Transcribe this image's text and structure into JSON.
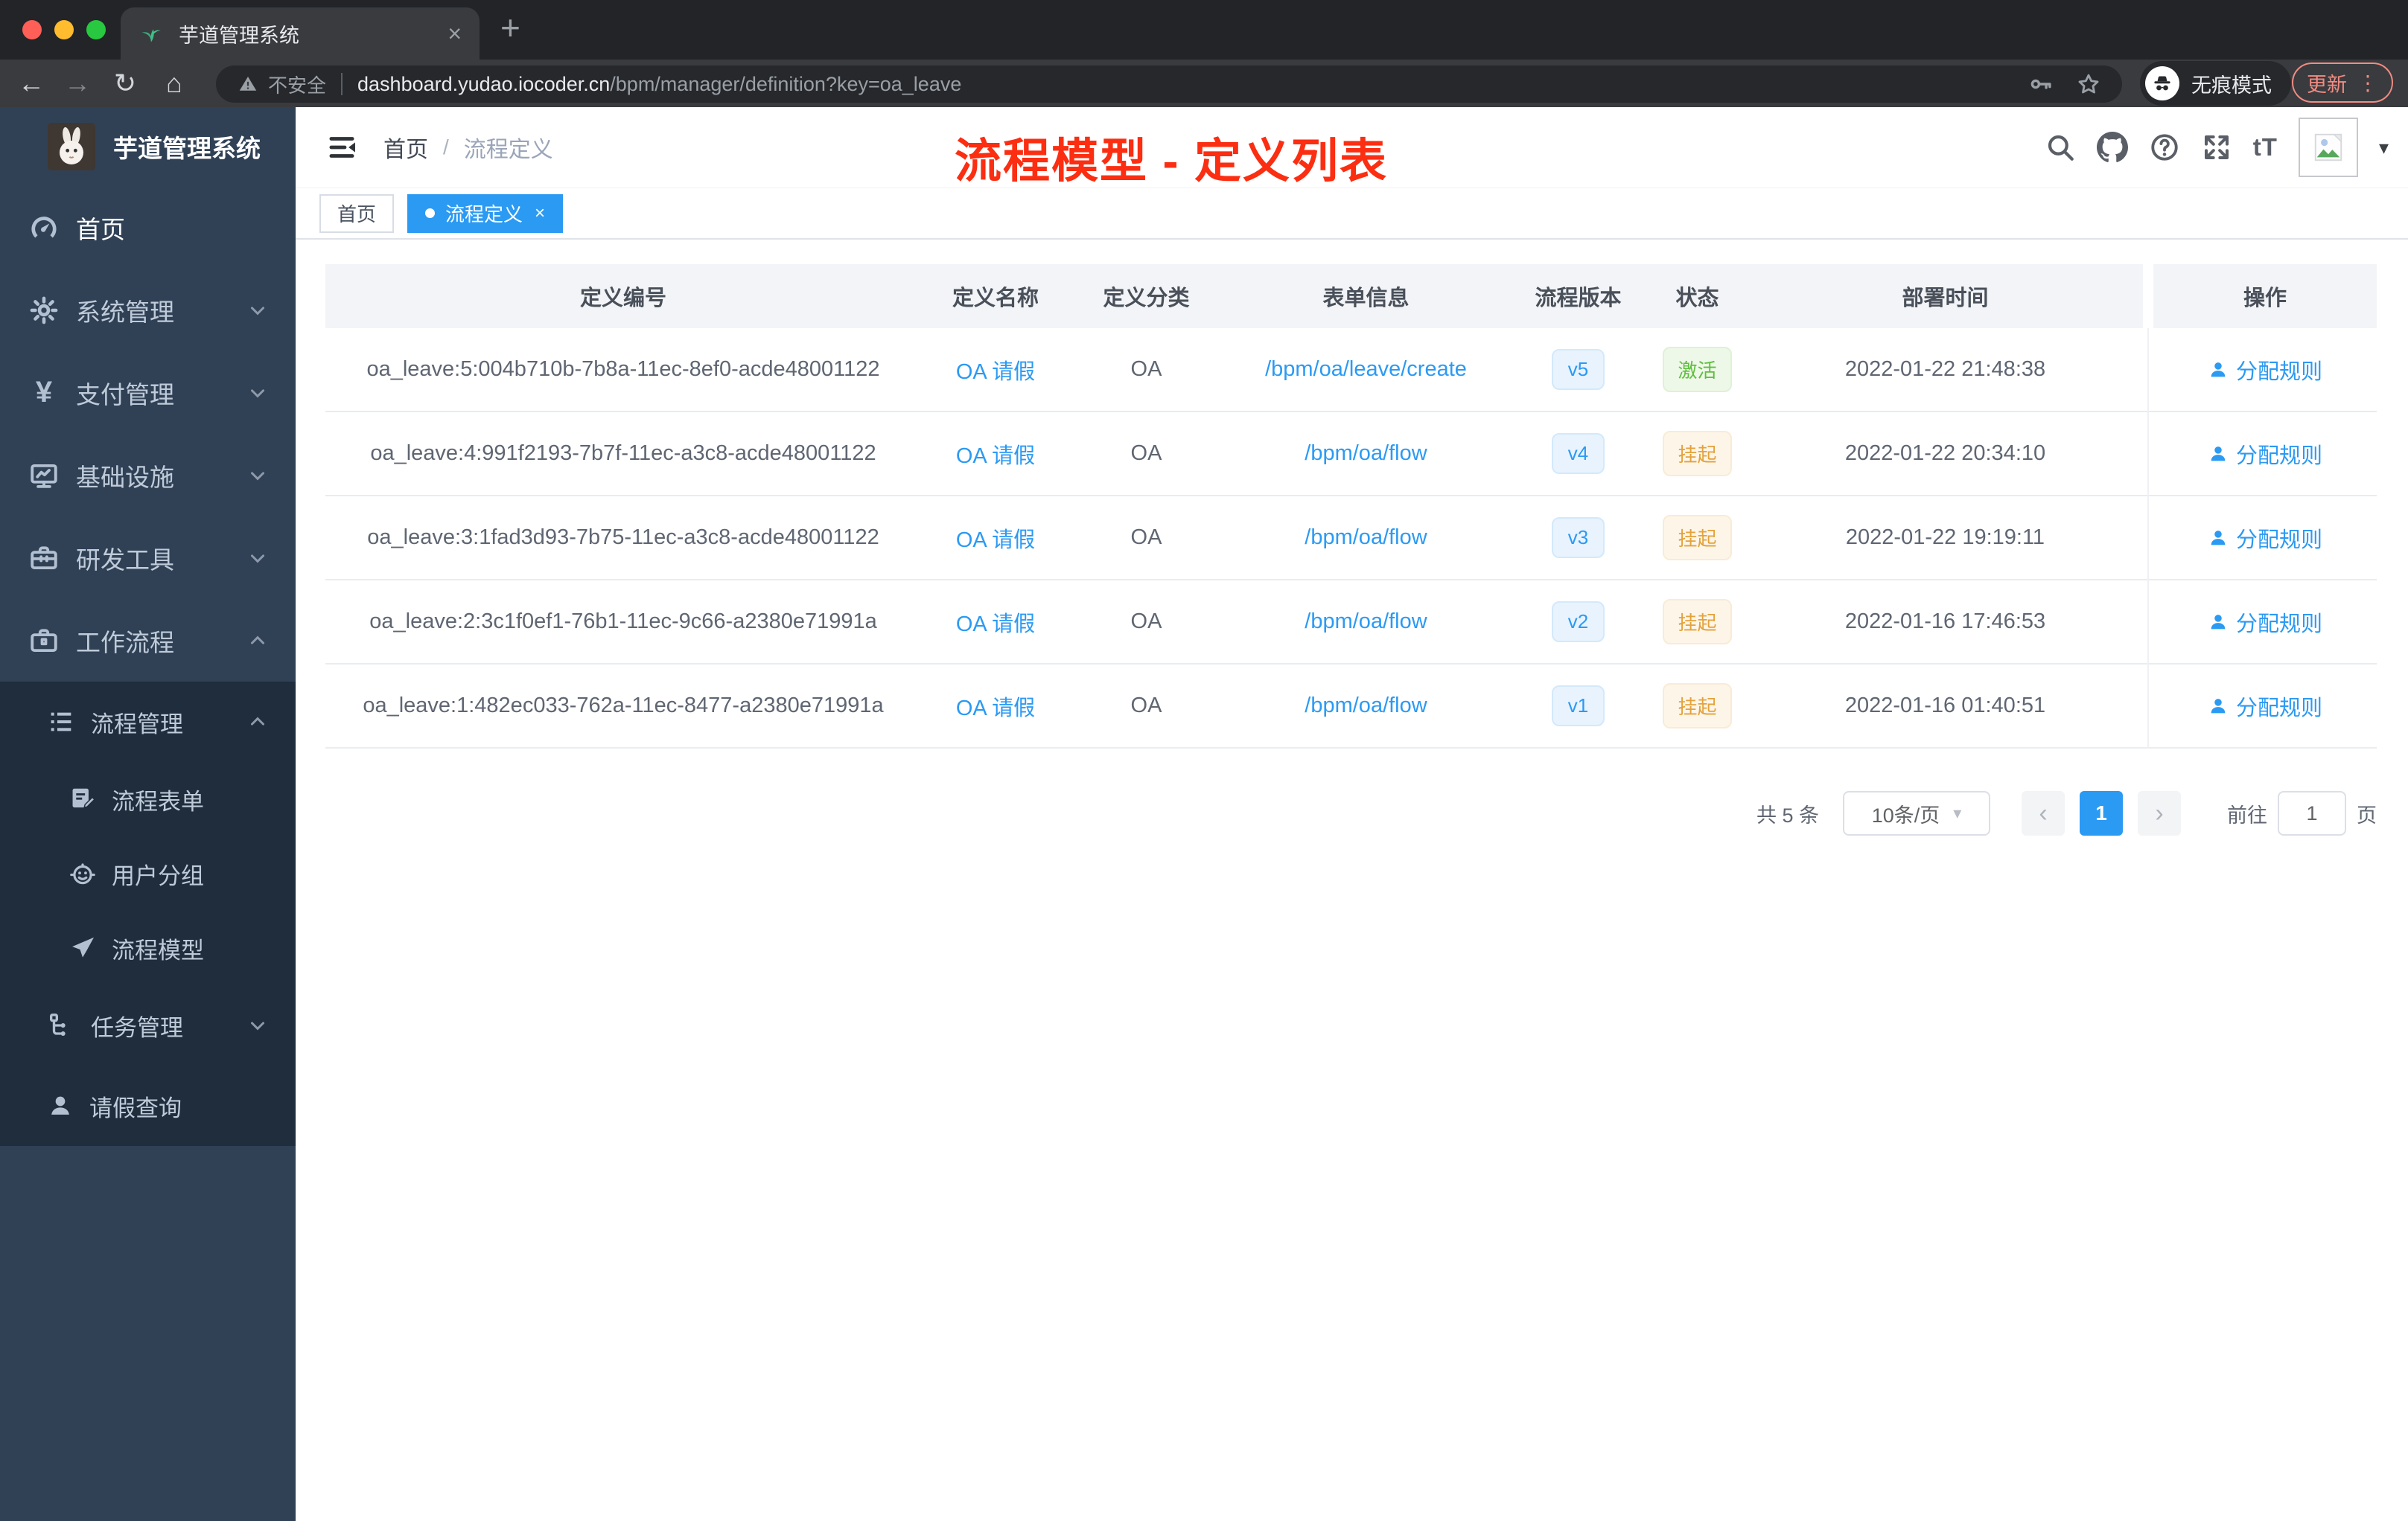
{
  "glyphs": {
    "close": "×",
    "plus": "+",
    "back": "←",
    "forward": "→",
    "reload": "↻",
    "home": "⌂",
    "kebab": "⋮",
    "caret_down": "▾",
    "chevron_left": "‹",
    "chevron_right": "›",
    "font_size": "tT",
    "yen": "¥",
    "slash": "/"
  },
  "colors": {
    "accent": "#2b9af3",
    "annotation_red": "#fb2e12",
    "sidebar_bg": "#304156",
    "submenu_bg": "#1f2d3d",
    "status_green": "#5fbe3f",
    "status_orange": "#e3a23c"
  },
  "browser": {
    "tab_title": "芋道管理系统",
    "security_label": "不安全",
    "url_host": "dashboard.yudao.iocoder.cn",
    "url_path": "/bpm/manager/definition?key=oa_leave",
    "incognito_label": "无痕模式",
    "update_label": "更新"
  },
  "header": {
    "breadcrumb_home": "首页",
    "breadcrumb_current": "流程定义",
    "annotation": "流程模型 - 定义列表"
  },
  "tags": {
    "home": "首页",
    "active": "流程定义"
  },
  "sidebar": {
    "app_title": "芋道管理系统",
    "items": [
      {
        "label": "首页"
      },
      {
        "label": "系统管理"
      },
      {
        "label": "支付管理"
      },
      {
        "label": "基础设施"
      },
      {
        "label": "研发工具"
      },
      {
        "label": "工作流程"
      },
      {
        "label": "流程管理"
      },
      {
        "label": "流程表单"
      },
      {
        "label": "用户分组"
      },
      {
        "label": "流程模型"
      },
      {
        "label": "任务管理"
      },
      {
        "label": "请假查询"
      }
    ]
  },
  "table": {
    "columns": [
      "定义编号",
      "定义名称",
      "定义分类",
      "表单信息",
      "流程版本",
      "状态",
      "部署时间",
      "操作"
    ],
    "action_label": "分配规则",
    "rows": [
      {
        "id": "oa_leave:5:004b710b-7b8a-11ec-8ef0-acde48001122",
        "name": "OA 请假",
        "category": "OA",
        "form": "/bpm/oa/leave/create",
        "version": "v5",
        "status": "激活",
        "deployed": "2022-01-22 21:48:38"
      },
      {
        "id": "oa_leave:4:991f2193-7b7f-11ec-a3c8-acde48001122",
        "name": "OA 请假",
        "category": "OA",
        "form": "/bpm/oa/flow",
        "version": "v4",
        "status": "挂起",
        "deployed": "2022-01-22 20:34:10"
      },
      {
        "id": "oa_leave:3:1fad3d93-7b75-11ec-a3c8-acde48001122",
        "name": "OA 请假",
        "category": "OA",
        "form": "/bpm/oa/flow",
        "version": "v3",
        "status": "挂起",
        "deployed": "2022-01-22 19:19:11"
      },
      {
        "id": "oa_leave:2:3c1f0ef1-76b1-11ec-9c66-a2380e71991a",
        "name": "OA 请假",
        "category": "OA",
        "form": "/bpm/oa/flow",
        "version": "v2",
        "status": "挂起",
        "deployed": "2022-01-16 17:46:53"
      },
      {
        "id": "oa_leave:1:482ec033-762a-11ec-8477-a2380e71991a",
        "name": "OA 请假",
        "category": "OA",
        "form": "/bpm/oa/flow",
        "version": "v1",
        "status": "挂起",
        "deployed": "2022-01-16 01:40:51"
      }
    ]
  },
  "pagination": {
    "total": "共 5 条",
    "page_size": "10条/页",
    "page": "1",
    "goto": "前往",
    "goto_value": "1",
    "page_unit": "页"
  }
}
